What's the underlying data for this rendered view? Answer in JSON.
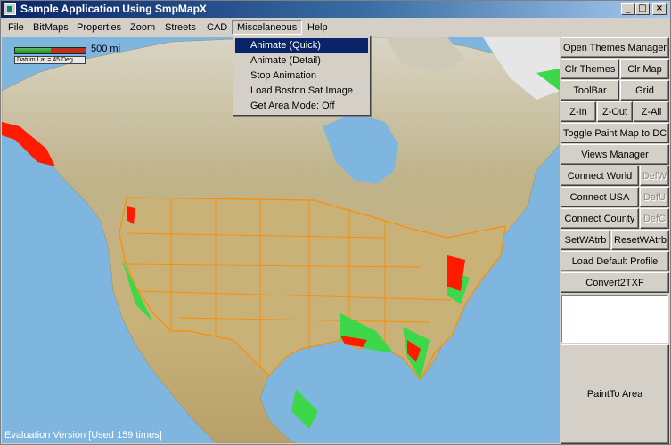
{
  "window": {
    "title": "Sample Application Using SmpMapX",
    "controls": {
      "minimize": "_",
      "maximize": "□",
      "close": "×"
    }
  },
  "menu": {
    "items": [
      "File",
      "BitMaps",
      "Properties",
      "Zoom",
      "Streets",
      "CAD",
      "Miscelaneous",
      "Help"
    ],
    "open_index": 6,
    "dropdown": [
      "Animate (Quick)",
      "Animate (Detail)",
      "Stop Animation",
      "Load Boston Sat Image",
      "Get Area Mode: Off"
    ],
    "selected_index": 0
  },
  "map": {
    "scale_label": "500 mi",
    "datum_label": "Datum Lat = 45 Deg",
    "eval_text": "Evaluation Version [Used 159 times]",
    "colors": {
      "ocean": "#7fb6e0",
      "land": "#c8b98a",
      "lowland": "#3cd84a",
      "border": "#ff8c00",
      "counties": "#e00000"
    }
  },
  "panel": {
    "buttons": {
      "open_themes_manager": "Open Themes Manager",
      "clr_themes": "Clr Themes",
      "clr_map": "Clr Map",
      "toolbar": "ToolBar",
      "grid": "Grid",
      "z_in": "Z-In",
      "z_out": "Z-Out",
      "z_all": "Z-All",
      "toggle_paint": "Toggle Paint Map to DC",
      "views_manager": "Views Manager",
      "connect_world": "Connect World",
      "def_w": "DefW",
      "connect_usa": "Connect USA",
      "def_u": "DefU",
      "connect_county": "Connect County",
      "def_c": "DefC",
      "set_watrb": "SetWAtrb",
      "reset_watrb": "ResetWAtrb",
      "load_default_profile": "Load Default Profile",
      "convert2txf": "Convert2TXF",
      "paint_to_area": "PaintTo Area"
    }
  }
}
